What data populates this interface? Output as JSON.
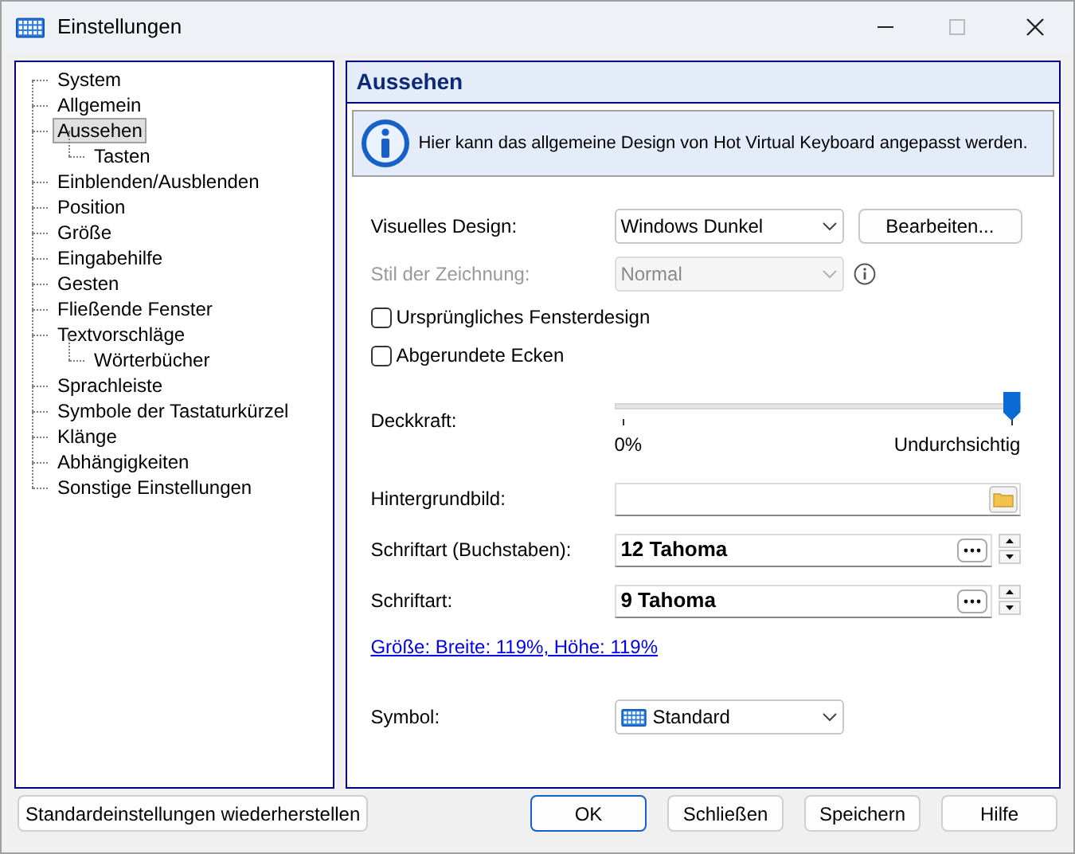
{
  "window": {
    "title": "Einstellungen"
  },
  "tree": [
    {
      "label": "System",
      "selected": false
    },
    {
      "label": "Allgemein",
      "selected": false
    },
    {
      "label": "Aussehen",
      "selected": true,
      "children": [
        {
          "label": "Tasten",
          "selected": false
        }
      ]
    },
    {
      "label": "Einblenden/Ausblenden",
      "selected": false
    },
    {
      "label": "Position",
      "selected": false
    },
    {
      "label": "Größe",
      "selected": false
    },
    {
      "label": "Eingabehilfe",
      "selected": false
    },
    {
      "label": "Gesten",
      "selected": false
    },
    {
      "label": "Fließende Fenster",
      "selected": false
    },
    {
      "label": "Textvorschläge",
      "selected": false,
      "children": [
        {
          "label": "Wörterbücher",
          "selected": false
        }
      ]
    },
    {
      "label": "Sprachleiste",
      "selected": false
    },
    {
      "label": "Symbole der Tastaturkürzel",
      "selected": false
    },
    {
      "label": "Klänge",
      "selected": false
    },
    {
      "label": "Abhängigkeiten",
      "selected": false
    },
    {
      "label": "Sonstige Einstellungen",
      "selected": false
    }
  ],
  "panel": {
    "title": "Aussehen",
    "info": "Hier kann das allgemeine Design von Hot Virtual Keyboard angepasst werden."
  },
  "settings": [
    {
      "kind": "combo",
      "label": "Visuelles Design:",
      "value": "Windows Dunkel",
      "disabled": false,
      "button": "Bearbeiten..."
    },
    {
      "kind": "combo",
      "label": "Stil der Zeichnung:",
      "value": "Normal",
      "disabled": true,
      "info": true
    },
    {
      "kind": "checkbox",
      "label": "Ursprüngliches Fensterdesign",
      "checked": false
    },
    {
      "kind": "checkbox",
      "label": "Abgerundete Ecken",
      "checked": false
    },
    {
      "kind": "slider",
      "label": "Deckkraft:",
      "level": 1,
      "min_label": "0%",
      "max_label": "Undurchsichtig"
    },
    {
      "kind": "file",
      "label": "Hintergrundbild:"
    },
    {
      "kind": "font",
      "label": "Schriftart (Buchstaben):",
      "value": "12 Tahoma"
    },
    {
      "kind": "font",
      "label": "Schriftart:",
      "value": "9 Tahoma"
    },
    {
      "kind": "link",
      "text": "Größe: Breite: 119%, Höhe: 119%"
    },
    {
      "kind": "icon_combo",
      "label": "Symbol:",
      "value": "Standard"
    }
  ],
  "buttons": [
    {
      "label": "Standardeinstellungen wiederherstellen",
      "default": false
    },
    {
      "label": "OK",
      "default": true
    },
    {
      "label": "Schließen",
      "default": false
    },
    {
      "label": "Speichern",
      "default": false
    },
    {
      "label": "Hilfe",
      "default": false
    }
  ]
}
